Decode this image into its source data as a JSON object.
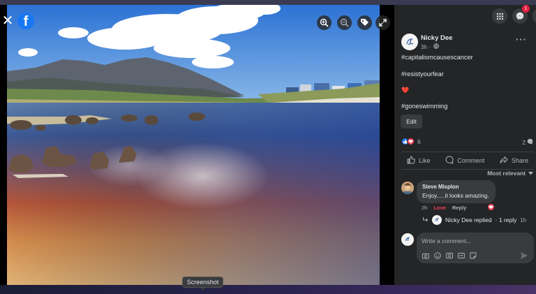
{
  "viewer": {
    "close_icon": "close-icon",
    "logo_letter": "f",
    "tools": [
      "zoom-in-icon",
      "zoom-out-icon",
      "tag-icon",
      "expand-icon"
    ],
    "tooltip": "Screenshot"
  },
  "header": {
    "notification_badge": "1"
  },
  "post": {
    "author": "Nicky Dee",
    "time": "3h",
    "privacy_icon": "globe-icon",
    "lines": [
      "#capitalismcausescancer",
      "#resistyourfear",
      "❤️",
      "#goneswimming"
    ],
    "edit_label": "Edit",
    "reaction_count": "6",
    "comment_count": "2",
    "actions": {
      "like": "Like",
      "comment": "Comment",
      "share": "Share"
    },
    "sort_label": "Most relevant"
  },
  "comment": {
    "author": "Steve Misplon",
    "text": "Enjoy.....it looks amazing.",
    "time": "2h",
    "love_label": "Love",
    "reply_label": "Reply",
    "replied_text": "Nicky Dee replied",
    "reply_count_label": "· 1 reply",
    "reply_time": "1h"
  },
  "composer": {
    "placeholder": "Write a comment...",
    "tools": [
      "camera-icon",
      "emoji-icon",
      "photo-icon",
      "gif-icon",
      "sticker-icon"
    ]
  },
  "colors": {
    "facebook_blue": "#1877f2",
    "love_red": "#f33e58",
    "panel_bg": "#242526"
  }
}
